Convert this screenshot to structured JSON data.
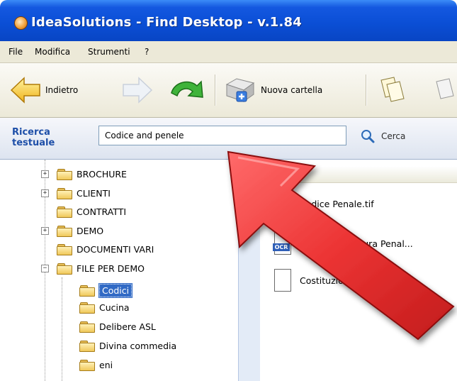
{
  "window": {
    "title": "IdeaSolutions - Find Desktop - v.1.84"
  },
  "menu": {
    "items": [
      "File",
      "Modifica",
      "Strumenti",
      "?"
    ]
  },
  "toolbar": {
    "back_label": "Indietro",
    "new_folder_label": "Nuova cartella"
  },
  "search": {
    "caption_line1": "Ricerca",
    "caption_line2": "testuale",
    "query": "Codice and penele",
    "button_label": "Cerca"
  },
  "tree": {
    "items": [
      {
        "label": "BROCHURE",
        "expander": "+"
      },
      {
        "label": "CLIENTI",
        "expander": "+"
      },
      {
        "label": "CONTRATTI",
        "expander": ""
      },
      {
        "label": "DEMO",
        "expander": "+"
      },
      {
        "label": "DOCUMENTI VARI",
        "expander": ""
      },
      {
        "label": "FILE PER DEMO",
        "expander": "−"
      },
      {
        "label": "Codici",
        "expander": ""
      },
      {
        "label": "Cucina",
        "expander": ""
      },
      {
        "label": "Delibere ASL",
        "expander": ""
      },
      {
        "label": "Divina commedia",
        "expander": ""
      },
      {
        "label": "eni",
        "expander": ""
      }
    ]
  },
  "files": {
    "items": [
      {
        "name": "Codice Penale.tif",
        "icon": "tif-icon"
      },
      {
        "name": "Codice procedura Penal...",
        "icon": "ocr-icon"
      },
      {
        "name": "Costituzione...",
        "icon": "doc-icon"
      }
    ]
  },
  "colors": {
    "titlebar": "#0b4fd6",
    "selection": "#316ac5",
    "arrow": "#e8302d"
  }
}
